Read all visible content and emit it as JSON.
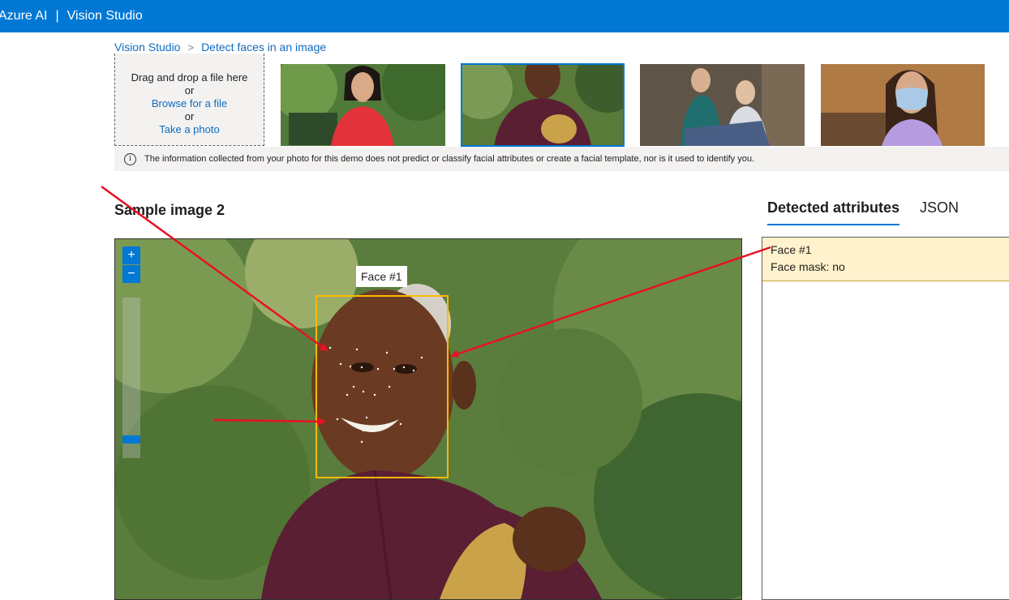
{
  "header": {
    "brand": "Azure AI",
    "separator": "|",
    "product": "Vision Studio",
    "bg": "#0078d4"
  },
  "breadcrumb": {
    "items": [
      "Vision Studio",
      "Detect faces in an image"
    ],
    "separator": ">"
  },
  "upload": {
    "drag_text": "Drag and drop a file here",
    "or1": "or",
    "browse": "Browse for a file",
    "or2": "or",
    "take_photo": "Take a photo"
  },
  "samples": [
    {
      "icon": "sample-woman-red-dress-image"
    },
    {
      "icon": "sample-man-smiling-image",
      "selected": true
    },
    {
      "icon": "sample-two-women-image"
    },
    {
      "icon": "sample-woman-face-mask-image"
    }
  ],
  "notice": "The information collected from your photo for this demo does not predict or classify facial attributes or create a facial template, nor is it used to identify you.",
  "section_title": "Sample image 2",
  "viewer": {
    "zoom_in": "+",
    "zoom_out": "−",
    "face_label": "Face #1",
    "box_color": "#ffb900"
  },
  "tabs": [
    {
      "label": "Detected attributes",
      "active": true
    },
    {
      "label": "JSON",
      "active": false
    }
  ],
  "attributes": {
    "face": "Face #1",
    "mask": "Face mask: no"
  },
  "annotation_color": "#e81123"
}
